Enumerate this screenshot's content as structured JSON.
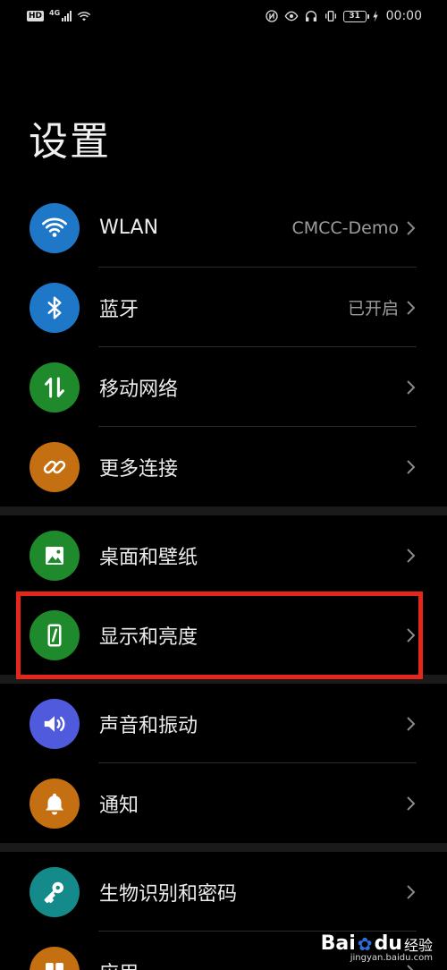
{
  "status_bar": {
    "hd": "HD",
    "network": "4G",
    "battery": "31",
    "time": "00:00"
  },
  "page": {
    "title": "设置"
  },
  "groups": [
    {
      "items": [
        {
          "label": "WLAN",
          "value": "CMCC-Demo",
          "icon": "wifi-icon",
          "color": "#1f77c8"
        },
        {
          "label": "蓝牙",
          "value": "已开启",
          "icon": "bluetooth-icon",
          "color": "#1f77c8"
        },
        {
          "label": "移动网络",
          "value": "",
          "icon": "mobile-data-icon",
          "color": "#1e8a2c"
        },
        {
          "label": "更多连接",
          "value": "",
          "icon": "link-icon",
          "color": "#c46f12"
        }
      ]
    },
    {
      "items": [
        {
          "label": "桌面和壁纸",
          "value": "",
          "icon": "wallpaper-icon",
          "color": "#1e8a2c"
        },
        {
          "label": "显示和亮度",
          "value": "",
          "icon": "display-brightness-icon",
          "color": "#1e8a2c"
        }
      ]
    },
    {
      "items": [
        {
          "label": "声音和振动",
          "value": "",
          "icon": "sound-icon",
          "color": "#4f5bdc"
        },
        {
          "label": "通知",
          "value": "",
          "icon": "bell-icon",
          "color": "#c46f12"
        }
      ]
    },
    {
      "items": [
        {
          "label": "生物识别和密码",
          "value": "",
          "icon": "key-icon",
          "color": "#148a8a"
        },
        {
          "label": "应用",
          "value": "",
          "icon": "apps-icon",
          "color": "#c46f12"
        }
      ]
    }
  ],
  "watermark": {
    "brand": "Bai",
    "brand_suffix": "du",
    "product": "经验",
    "url": "jingyan.baidu.com"
  }
}
